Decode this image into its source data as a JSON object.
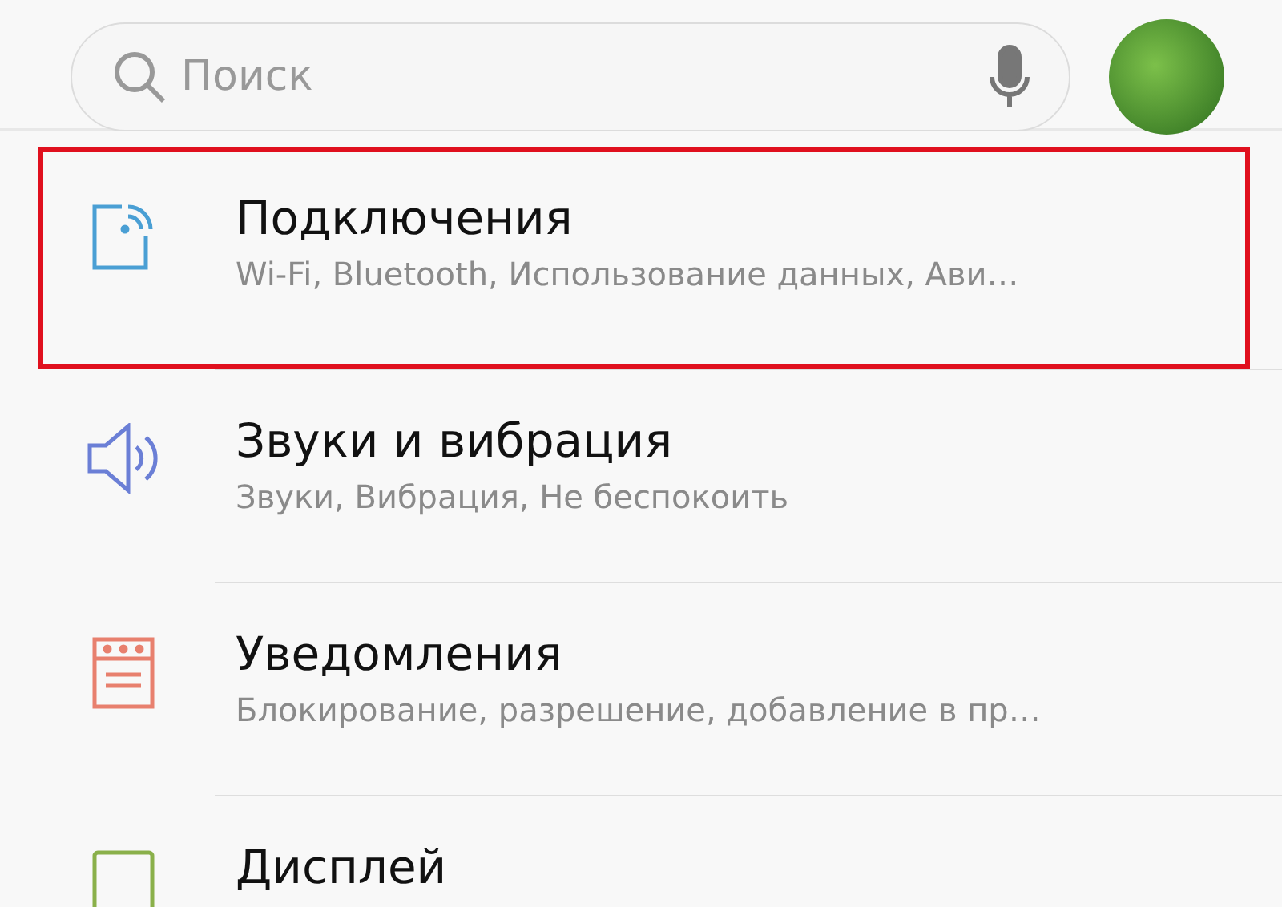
{
  "search": {
    "placeholder": "Поиск"
  },
  "items": [
    {
      "kind": "connections",
      "color": "#4a9fd4",
      "title": "Подключения",
      "subtitle": "Wi-Fi, Bluetooth, Использование данных, Ави…",
      "highlighted": true
    },
    {
      "kind": "sound",
      "color": "#6b7fd6",
      "title": "Звуки и вибрация",
      "subtitle": "Звуки, Вибрация, Не беспокоить",
      "highlighted": false
    },
    {
      "kind": "notifications",
      "color": "#e8806e",
      "title": "Уведомления",
      "subtitle": "Блокирование, разрешение, добавление в пр…",
      "highlighted": false
    },
    {
      "kind": "display",
      "color": "#8ab04a",
      "title": "Дисплей",
      "highlighted": false
    }
  ]
}
